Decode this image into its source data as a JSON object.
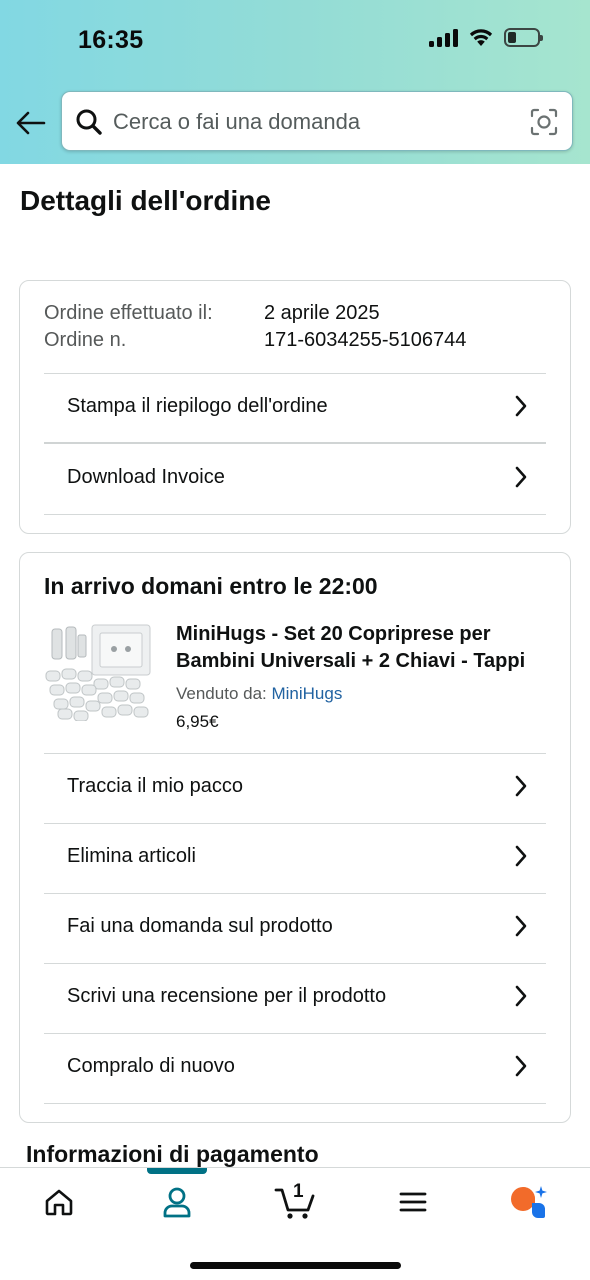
{
  "status_bar": {
    "time": "16:35"
  },
  "search": {
    "placeholder": "Cerca o fai una domanda"
  },
  "page": {
    "title": "Dettagli dell'ordine"
  },
  "order_summary": {
    "placed_label": "Ordine effettuato il:",
    "placed_value": "2 aprile 2025",
    "number_label": "Ordine n.",
    "number_value": "171-6034255-5106744",
    "actions": [
      "Stampa il riepilogo dell'ordine",
      "Download Invoice"
    ]
  },
  "shipment": {
    "title": "In arrivo domani entro le 22:00",
    "product": {
      "name_line1": "MiniHugs - Set 20 Copriprese per",
      "name_line2": "Bambini Universali + 2 Chiavi - Tappi",
      "seller_label": "Venduto da: ",
      "seller_name": "MiniHugs",
      "price": "6,95€"
    },
    "actions": [
      "Traccia il mio pacco",
      "Elimina articoli",
      "Fai una domanda sul prodotto",
      "Scrivi una recensione per il prodotto",
      "Compralo di nuovo"
    ]
  },
  "next_section": {
    "title": "Informazioni di pagamento"
  },
  "bottom_nav": {
    "cart_count": "1",
    "items": [
      "home-icon",
      "account-icon",
      "cart-icon",
      "menu-icon",
      "rufus-icon"
    ],
    "active": "account-icon"
  },
  "colors": {
    "accent": "#007185",
    "link": "#2162a1",
    "header_gradient_start": "#82d8e3",
    "header_gradient_end": "#a6e5cf"
  }
}
